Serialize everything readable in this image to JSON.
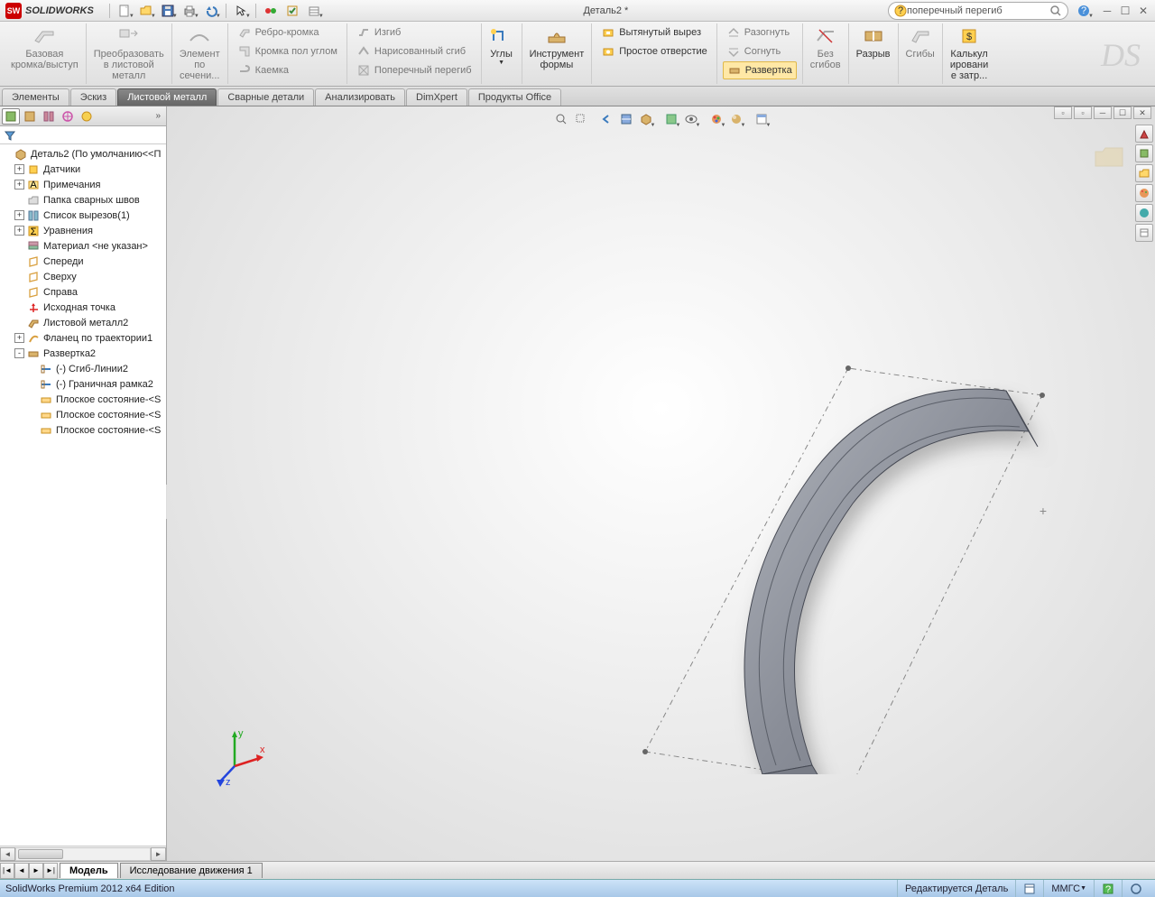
{
  "app": {
    "name": "SOLIDWORKS",
    "title": "Деталь2 *"
  },
  "search": {
    "value": "поперечный перегиб"
  },
  "ribbon": {
    "base_flange": "Базовая\nкромка/выступ",
    "convert": "Преобразовать\nв листовой\nметалл",
    "element": "Элемент\nпо\nсечени...",
    "edge_flange": "Ребро-кромка",
    "miter_flange": "Кромка пол углом",
    "hem": "Каемка",
    "jog": "Изгиб",
    "sketched_bend": "Нарисованный сгиб",
    "cross_break": "Поперечный перегиб",
    "corners": "Углы",
    "forming_tool": "Инструмент\nформы",
    "extruded_cut": "Вытянутый вырез",
    "simple_hole": "Простое отверстие",
    "unfold": "Разогнуть",
    "fold": "Согнуть",
    "no_bends": "Без\nсгибов",
    "rip": "Разрыв",
    "bends": "Сгибы",
    "flatten": "Развертка",
    "costing": "Калькул\nировани\nе затр..."
  },
  "tabs": [
    "Элементы",
    "Эскиз",
    "Листовой металл",
    "Сварные детали",
    "Анализировать",
    "DimXpert",
    "Продукты Office"
  ],
  "active_tab": 2,
  "tree": {
    "root": "Деталь2  (По умолчанию<<П",
    "items": [
      {
        "l": "Датчики",
        "exp": "+",
        "indent": 1,
        "icon": "sensor"
      },
      {
        "l": "Примечания",
        "exp": "+",
        "indent": 1,
        "icon": "annot"
      },
      {
        "l": "Папка сварных швов",
        "exp": "",
        "indent": 1,
        "icon": "folder-weld"
      },
      {
        "l": "Список вырезов(1)",
        "exp": "+",
        "indent": 1,
        "icon": "cutlist"
      },
      {
        "l": "Уравнения",
        "exp": "+",
        "indent": 1,
        "icon": "sigma"
      },
      {
        "l": "Материал <не указан>",
        "exp": "",
        "indent": 1,
        "icon": "material"
      },
      {
        "l": "Спереди",
        "exp": "",
        "indent": 1,
        "icon": "plane"
      },
      {
        "l": "Сверху",
        "exp": "",
        "indent": 1,
        "icon": "plane"
      },
      {
        "l": "Справа",
        "exp": "",
        "indent": 1,
        "icon": "plane"
      },
      {
        "l": "Исходная точка",
        "exp": "",
        "indent": 1,
        "icon": "origin"
      },
      {
        "l": "Листовой металл2",
        "exp": "",
        "indent": 1,
        "icon": "sheetmetal"
      },
      {
        "l": "Фланец по траектории1",
        "exp": "+",
        "indent": 1,
        "icon": "swept"
      },
      {
        "l": "Развертка2",
        "exp": "-",
        "indent": 1,
        "icon": "flatten"
      },
      {
        "l": "(-) Сгиб-Линии2",
        "exp": "",
        "indent": 2,
        "icon": "bendline"
      },
      {
        "l": "(-) Граничная рамка2",
        "exp": "",
        "indent": 2,
        "icon": "bendline"
      },
      {
        "l": "Плоское состояние-<S",
        "exp": "",
        "indent": 2,
        "icon": "flat"
      },
      {
        "l": "Плоское состояние-<S",
        "exp": "",
        "indent": 2,
        "icon": "flat"
      },
      {
        "l": "Плоское состояние-<S",
        "exp": "",
        "indent": 2,
        "icon": "flat"
      }
    ]
  },
  "bottom_tabs": {
    "model": "Модель",
    "motion": "Исследование движения 1"
  },
  "status": {
    "edition": "SolidWorks Premium 2012 x64 Edition",
    "editing": "Редактируется Деталь",
    "units": "ММГС"
  },
  "triad": {
    "x": "x",
    "y": "y",
    "z": "z"
  }
}
